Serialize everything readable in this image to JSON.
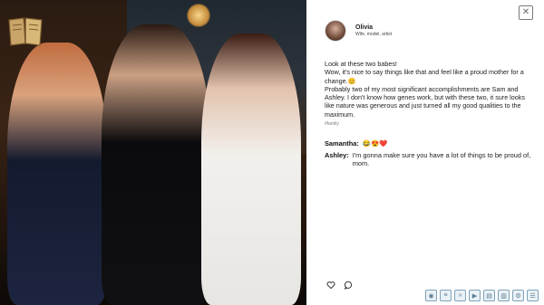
{
  "post": {
    "author": "Olivia",
    "author_subtitle": "Wife, model, artist",
    "body": [
      "Look at these two babes!",
      "Wow, it's nice to say things like that and feel like a proud mother for a change.😊",
      "Probably two of my most significant accomplishments are Sam and Ashley. I don't know how genes work, but with these two, it sure looks like nature was generous and just turned all my good qualities to the maximum."
    ],
    "hashtag": "#family"
  },
  "comments": [
    {
      "name": "Samantha:",
      "text": "😂😍❤️"
    },
    {
      "name": "Ashley:",
      "text": "I'm gonna make sure you have a lot of things to be proud of, mom."
    }
  ],
  "icons": {
    "close": "close-icon",
    "like": "heart-icon",
    "comment": "comment-icon",
    "gallery": "book-icon"
  },
  "toolbar": [
    "eye-icon",
    "history-icon",
    "skip-icon",
    "auto-icon",
    "save-icon",
    "load-icon",
    "settings-icon",
    "menu-icon"
  ],
  "colors": {
    "panel_bg": "#ffffff",
    "toolbar_border": "#7fa1b8"
  }
}
